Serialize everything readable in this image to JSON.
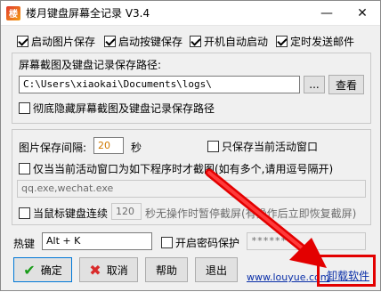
{
  "window": {
    "title": "楼月键盘屏幕全记录 V3.4",
    "app_icon_glyph": "楼",
    "minimize_glyph": "—",
    "close_glyph": "✕"
  },
  "options": {
    "start_image_save": "启动图片保存",
    "start_key_save": "启动按键保存",
    "auto_start": "开机自动启动",
    "timed_email": "定时发送邮件"
  },
  "path_group": {
    "label": "屏幕截图及键盘记录保存路径:",
    "path_value": "C:\\Users\\xiaokai\\Documents\\logs\\",
    "browse_label": "...",
    "view_label": "查看",
    "hide_label": "彻底隐藏屏幕截图及键盘记录保存路径"
  },
  "image_group": {
    "interval_label": "图片保存间隔:",
    "interval_value": "20",
    "interval_unit": "秒",
    "active_window_only": "只保存当前活动窗口",
    "program_screenshot_label": "仅当当前活动窗口为如下程序时才截图(如有多个,请用逗号隔开)",
    "program_list": "qq.exe,wechat.exe",
    "idle_pause_label": "当鼠标键盘连续",
    "idle_seconds": "120",
    "idle_suffix": "秒无操作时暂停截屏(有操作后立即恢复截屏)"
  },
  "hotkey": {
    "label": "热键",
    "value": "Alt + K",
    "password_label": "开启密码保护",
    "password_value": "******"
  },
  "buttons": {
    "ok": "确定",
    "cancel": "取消",
    "help": "帮助",
    "exit": "退出"
  },
  "links": {
    "website": "www.louyue.com",
    "uninstall": "卸载软件"
  },
  "colors": {
    "annotation_red": "#e30000",
    "link_blue": "#0a2fa8",
    "ok_green": "#1a9c1a",
    "cancel_red": "#d92b2b"
  }
}
